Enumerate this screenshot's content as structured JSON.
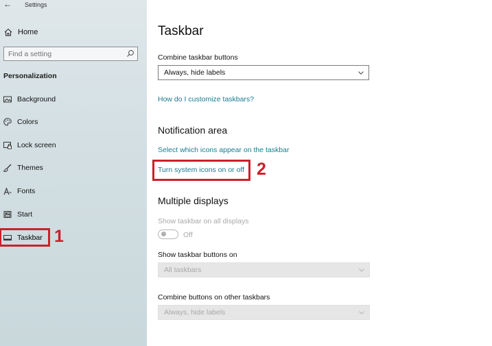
{
  "window": {
    "title": "Settings"
  },
  "sidebar": {
    "home_label": "Home",
    "search_placeholder": "Find a setting",
    "section_label": "Personalization",
    "items": [
      {
        "label": "Background",
        "icon": "picture-icon"
      },
      {
        "label": "Colors",
        "icon": "palette-icon"
      },
      {
        "label": "Lock screen",
        "icon": "lock-screen-icon"
      },
      {
        "label": "Themes",
        "icon": "brush-icon"
      },
      {
        "label": "Fonts",
        "icon": "font-icon"
      },
      {
        "label": "Start",
        "icon": "start-icon"
      },
      {
        "label": "Taskbar",
        "icon": "taskbar-icon",
        "active": true
      }
    ]
  },
  "annotations": {
    "marker1": "1",
    "marker2": "2",
    "color": "#cc1f2b"
  },
  "main": {
    "title": "Taskbar",
    "combine_label": "Combine taskbar buttons",
    "combine_value": "Always, hide labels",
    "customize_link": "How do I customize taskbars?",
    "notification_heading": "Notification area",
    "select_icons_link": "Select which icons appear on the taskbar",
    "system_icons_link": "Turn system icons on or off",
    "multiple_heading": "Multiple displays",
    "show_all_label": "Show taskbar on all displays",
    "toggle_state": "Off",
    "show_buttons_label": "Show taskbar buttons on",
    "show_buttons_value": "All taskbars",
    "combine_other_label": "Combine buttons on other taskbars",
    "combine_other_value": "Always, hide labels"
  },
  "colors": {
    "link": "#1a7b8f",
    "accent_red": "#cc1f2b"
  }
}
